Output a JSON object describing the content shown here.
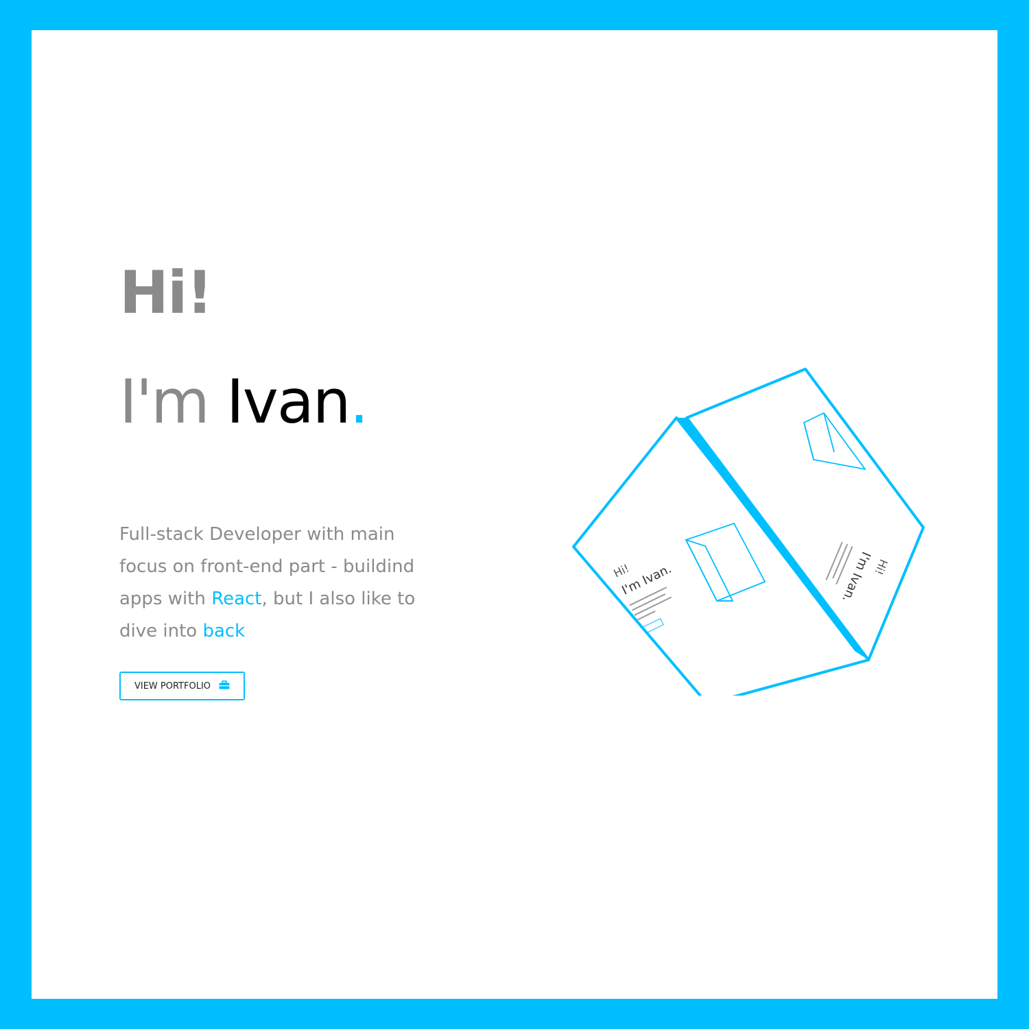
{
  "hero": {
    "greeting": "Hi!",
    "intro_lead": "I'm ",
    "intro_name": "Ivan",
    "intro_dot": ".",
    "bio": {
      "part1": "Full-stack Developer with main focus on front-end part - buildind apps with ",
      "highlight1": "React",
      "part2": ", but I also like to dive into ",
      "highlight2": "back"
    },
    "cta_label": "VIEW PORTFOLIO",
    "cta_icon": "briefcase-icon"
  },
  "cube_face_text": {
    "hi": "Hi!",
    "name": "I'm Ivan."
  },
  "colors": {
    "accent": "#00bfff",
    "muted_text": "#8a8a8a",
    "dark_text": "#000000",
    "background": "#ffffff"
  }
}
